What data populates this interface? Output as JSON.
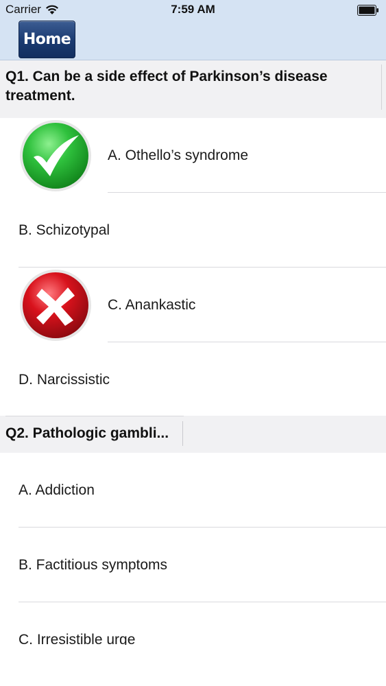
{
  "status_bar": {
    "carrier": "Carrier",
    "time": "7:59 AM",
    "wifi_icon": "wifi-icon",
    "battery_icon": "battery-icon"
  },
  "nav": {
    "home_label": "Home"
  },
  "colors": {
    "nav_background": "#d5e3f3",
    "home_button": "#1a3a70",
    "correct_green": "#2fc13d",
    "wrong_red": "#d8121c",
    "question_background": "#f1f1f3"
  },
  "questions": [
    {
      "text": "Q1. Can be a side effect of Parkinson’s disease treatment.",
      "options": [
        {
          "label": "A. Othello’s syndrome",
          "state": "correct",
          "icon": "checkmark-icon"
        },
        {
          "label": "B. Schizotypal",
          "state": "none"
        },
        {
          "label": "C. Anankastic",
          "state": "wrong",
          "icon": "cross-icon"
        },
        {
          "label": "D. Narcissistic",
          "state": "none"
        }
      ]
    },
    {
      "text": "Q2. Pathologic gambli...",
      "options": [
        {
          "label": "A. Addiction",
          "state": "none"
        },
        {
          "label": "B. Factitious symptoms",
          "state": "none"
        },
        {
          "label": "C. Irresistible urge",
          "state": "none"
        }
      ]
    }
  ]
}
